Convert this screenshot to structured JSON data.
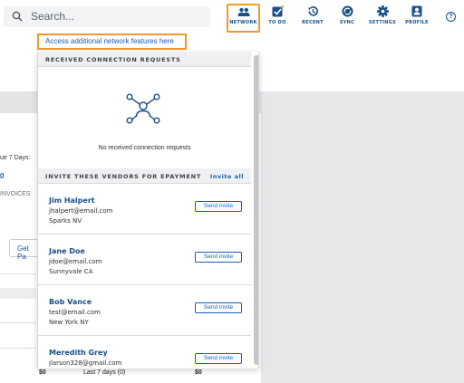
{
  "search": {
    "placeholder": "Search..."
  },
  "nav": [
    {
      "label": "NETWORK",
      "icon": "people-icon",
      "active": true
    },
    {
      "label": "TO DO",
      "icon": "todo-check-icon",
      "active": false
    },
    {
      "label": "RECENT",
      "icon": "history-icon",
      "active": false
    },
    {
      "label": "SYNC",
      "icon": "sync-icon",
      "active": false
    },
    {
      "label": "SETTINGS",
      "icon": "gear-icon",
      "active": false
    },
    {
      "label": "PROFILE",
      "icon": "profile-card-icon",
      "active": false
    }
  ],
  "help": {
    "label": "?"
  },
  "tooltip": {
    "text": "Access additional network features here"
  },
  "panel": {
    "received_header": "RECEIVED CONNECTION REQUESTS",
    "empty_text": "No received connection requests",
    "invite_header": "INVITE THESE VENDORS FOR EPAYMENT",
    "invite_all": "Invite all",
    "vendors": [
      {
        "name": "Jim Halpert",
        "email": "jhalpert@email.com",
        "location": "Sparks NV",
        "button": "Send invite"
      },
      {
        "name": "Jane Doe",
        "email": "jdoe@email.com",
        "location": "Sunnyvale CA",
        "button": "Send invite"
      },
      {
        "name": "Bob Vance",
        "email": "test@email.com",
        "location": "New York NY",
        "button": "Send invite"
      },
      {
        "name": "Meredith Grey",
        "email": "jlarson328@gmail.com",
        "location": "",
        "button": "Send invite"
      }
    ]
  },
  "background": {
    "due_label": "ue 7 Days:",
    "due_value": "0",
    "invoices_label": "INVOICES",
    "get_paid": "Get Pa",
    "bottom_left_value": "$0",
    "bottom_middle_label": "Last 7 days (0)",
    "bottom_right_value": "$0"
  },
  "colors": {
    "accent": "#1a5fb4",
    "highlight": "#f09a2e",
    "nav_text": "#1a4f8a"
  }
}
